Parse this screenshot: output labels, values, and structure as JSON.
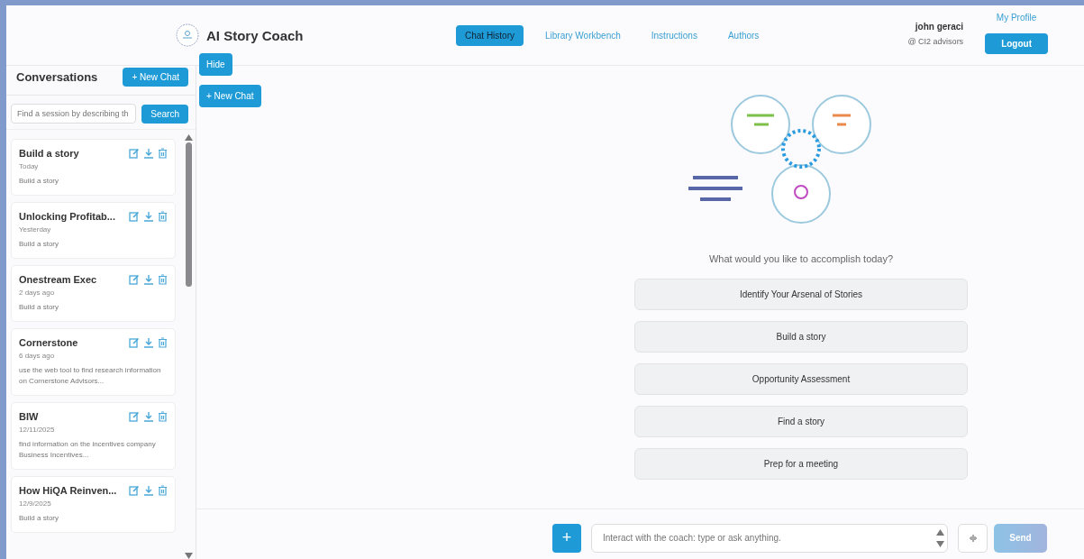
{
  "header": {
    "title": "AI Story Coach",
    "nav": [
      {
        "label": "Chat History",
        "selected": true
      },
      {
        "label": "Library Workbench",
        "selected": false
      },
      {
        "label": "Instructions",
        "selected": false
      },
      {
        "label": "Authors",
        "selected": false
      }
    ],
    "user": {
      "name": "john geraci",
      "org": "@ CI2 advisors"
    },
    "profile_link": "My Profile",
    "logout": "Logout"
  },
  "sidebar": {
    "title": "Conversations",
    "new_chat": "+ New Chat",
    "search": {
      "placeholder": "Find a session by describing th",
      "button": "Search"
    },
    "items": [
      {
        "title": "Build a story",
        "date": "Today",
        "summary": "Build a story"
      },
      {
        "title": "Unlocking Profitab...",
        "date": "Yesterday",
        "summary": "Build a story"
      },
      {
        "title": "Onestream Exec",
        "date": "2 days ago",
        "summary": "Build a story"
      },
      {
        "title": "Cornerstone",
        "date": "6 days ago",
        "summary": "use the web tool to find research information on Cornerstone Advisors..."
      },
      {
        "title": "BIW",
        "date": "12/11/2025",
        "summary": "find information on the incentives company Business Incentives..."
      },
      {
        "title": "How HiQA Reinven...",
        "date": "12/9/2025",
        "summary": "Build a story"
      }
    ]
  },
  "floating": {
    "hide": "Hide",
    "new_chat": "+ New Chat"
  },
  "main": {
    "prompt": "What would you like to accomplish today?",
    "options": [
      "Identify Your Arsenal of Stories",
      "Build a story",
      "Opportunity Assessment",
      "Find a story",
      "Prep for a meeting"
    ]
  },
  "composer": {
    "add": "+",
    "placeholder": "Interact with the coach: type or ask anything.",
    "send": "Send",
    "send_disabled": true
  }
}
